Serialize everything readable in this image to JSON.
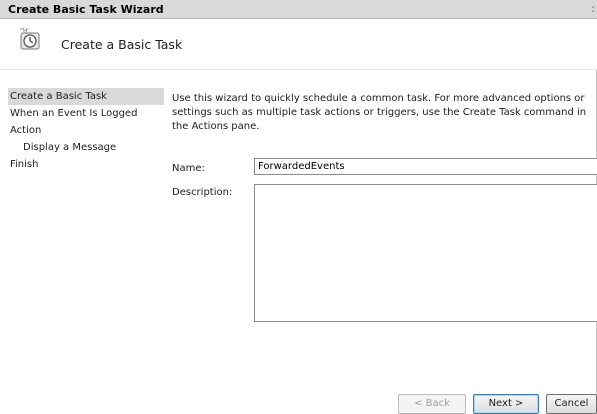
{
  "window": {
    "title": "Create Basic Task Wizard"
  },
  "header": {
    "title": "Create a Basic Task",
    "icon": "task-scheduler-clock-icon"
  },
  "sidebar": {
    "items": [
      {
        "label": "Create a Basic Task",
        "active": true
      },
      {
        "label": "When an Event Is Logged",
        "active": false
      },
      {
        "label": "Action",
        "active": false
      },
      {
        "label": "Display a Message",
        "active": false,
        "sub": true
      },
      {
        "label": "Finish",
        "active": false
      }
    ]
  },
  "main": {
    "intro": "Use this wizard to quickly schedule a common task.  For more advanced options or settings such as multiple task actions or triggers, use the Create Task command in the Actions pane.",
    "name_label": "Name:",
    "name_value": "ForwardedEvents",
    "description_label": "Description:",
    "description_value": ""
  },
  "buttons": {
    "back": "< Back",
    "next": "Next >",
    "cancel": "Cancel"
  },
  "colors": {
    "titlebar": "#d9d9d9",
    "active_nav": "#d9d9d9",
    "default_button_border": "#3c7fb1"
  }
}
